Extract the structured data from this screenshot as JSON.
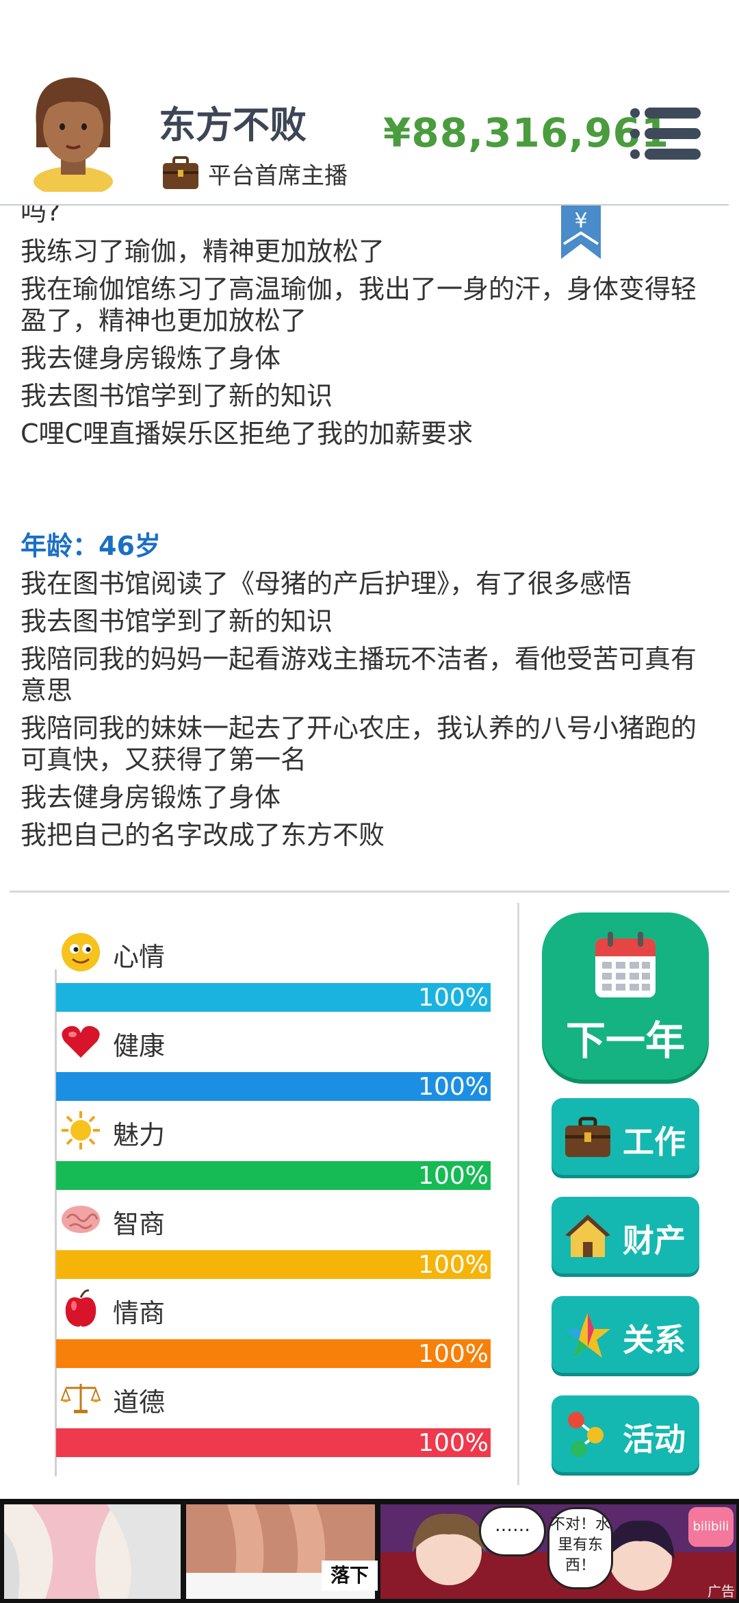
{
  "header": {
    "username": "东方不败",
    "job_title": "平台首席主播",
    "money": "¥88,316,961"
  },
  "log": {
    "top_cut": "吗?",
    "bookmark_symbol": "¥",
    "block1": [
      "我练习了瑜伽，精神更加放松了",
      "我在瑜伽馆练习了高温瑜伽，我出了一身的汗，身体变得轻盈了，精神也更加放松了",
      "我去健身房锻炼了身体",
      "我去图书馆学到了新的知识",
      "C哩C哩直播娱乐区拒绝了我的加薪要求"
    ],
    "age_label": "年龄：46岁",
    "block2": [
      "我在图书馆阅读了《母猪的产后护理》，有了很多感悟",
      "我去图书馆学到了新的知识",
      "我陪同我的妈妈一起看游戏主播玩不洁者，看他受苦可真有意思",
      "我陪同我的妹妹一起去了开心农庄，我认养的八号小猪跑的可真快，又获得了第一名",
      "我去健身房锻炼了身体",
      "我把自己的名字改成了东方不败"
    ]
  },
  "stats": [
    {
      "label": "心情",
      "value": "100%",
      "fill": 1.0,
      "color": "#1ab3e0",
      "icon": "smiley-icon"
    },
    {
      "label": "健康",
      "value": "100%",
      "fill": 1.0,
      "color": "#1c8fe3",
      "icon": "heart-icon"
    },
    {
      "label": "魅力",
      "value": "100%",
      "fill": 1.0,
      "color": "#16bb55",
      "icon": "sun-icon"
    },
    {
      "label": "智商",
      "value": "100%",
      "fill": 1.0,
      "color": "#f6b40a",
      "icon": "brain-icon"
    },
    {
      "label": "情商",
      "value": "100%",
      "fill": 1.0,
      "color": "#f7800a",
      "icon": "apple-icon"
    },
    {
      "label": "道德",
      "value": "100%",
      "fill": 1.0,
      "color": "#ee3a4c",
      "icon": "scale-icon"
    }
  ],
  "actions": {
    "next_year": "下一年",
    "work": "工作",
    "property": "财产",
    "relations": "关系",
    "activities": "活动"
  },
  "ad": {
    "tag": "广告",
    "bubble1": "……",
    "bubble2": "不对！水里有东西！",
    "bili": "bilibili",
    "luoxia": "落下"
  },
  "colors": {
    "money": "#4a9c3e",
    "age": "#1a6fc4",
    "next_year_bg": "#15b381",
    "action_bg": "#14b8b0"
  }
}
